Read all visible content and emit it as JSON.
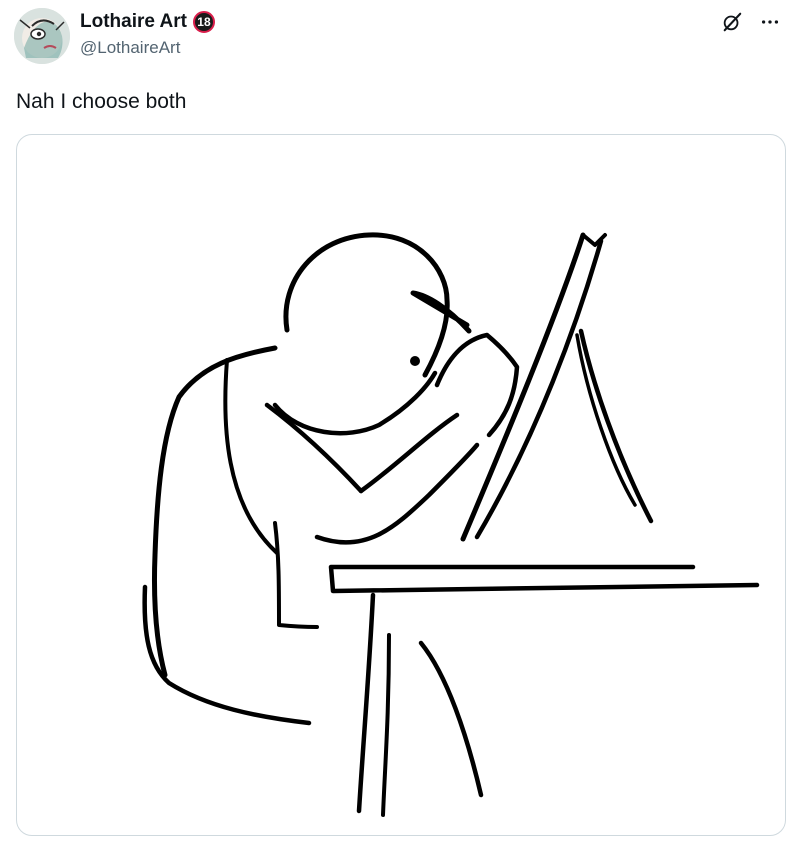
{
  "post": {
    "author": {
      "display_name": "Lothaire Art",
      "badge": "18",
      "handle": "@LothaireArt"
    },
    "text": "Nah I choose both",
    "icons": {
      "grok": "grok-slash-icon",
      "more": "more-dots-icon",
      "badge": "age-18-badge-icon"
    },
    "media": {
      "kind": "line-drawing",
      "subject": "figure hunched over a drawing easel at a desk"
    },
    "colors": {
      "text": "#0f1419",
      "secondary": "#536471",
      "border": "#cfd9de",
      "badge_ring": "#d91e4b"
    }
  }
}
